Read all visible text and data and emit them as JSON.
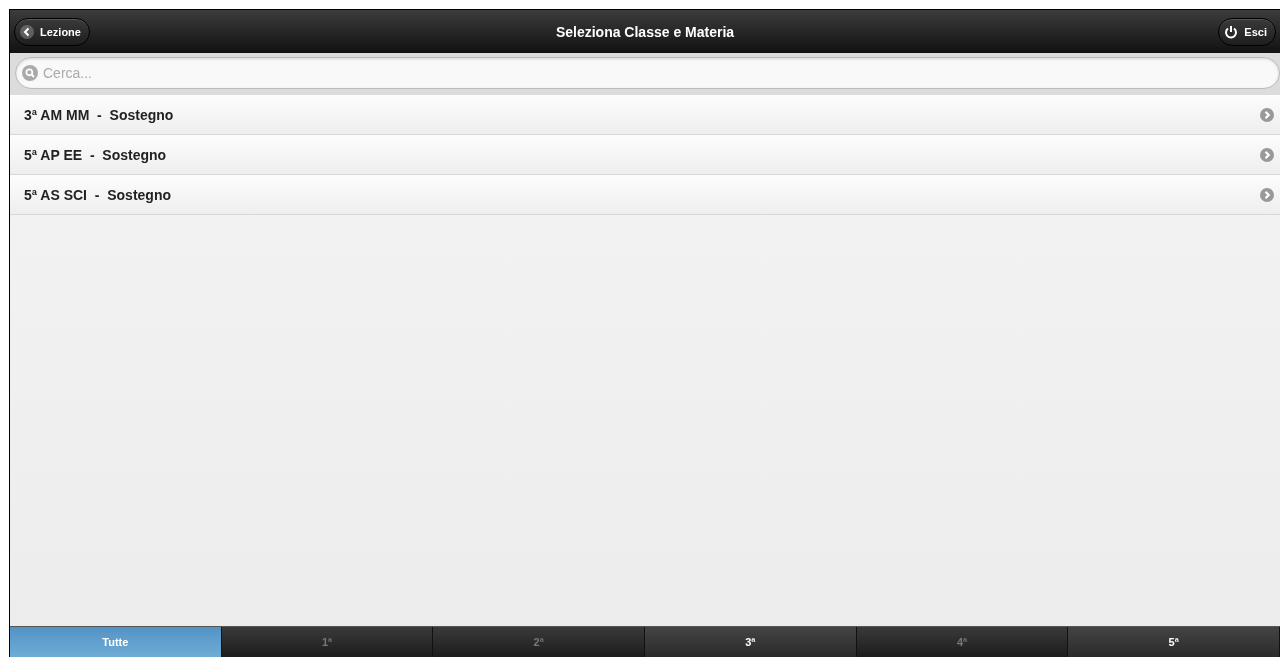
{
  "header": {
    "back_button": "Lezione",
    "title": "Seleziona Classe e Materia",
    "exit_button": "Esci"
  },
  "search": {
    "placeholder": "Cerca..."
  },
  "list": [
    {
      "label": "3ª AM MM  -  Sostegno"
    },
    {
      "label": "5ª AP EE  -  Sostegno"
    },
    {
      "label": "5ª AS SCI  -  Sostegno"
    }
  ],
  "tabs": [
    {
      "label": "Tutte",
      "selected": true,
      "disabled": false
    },
    {
      "label": "1ª",
      "selected": false,
      "disabled": true
    },
    {
      "label": "2ª",
      "selected": false,
      "disabled": true
    },
    {
      "label": "3ª",
      "selected": false,
      "disabled": false
    },
    {
      "label": "4ª",
      "selected": false,
      "disabled": true
    },
    {
      "label": "5ª",
      "selected": false,
      "disabled": false
    }
  ]
}
